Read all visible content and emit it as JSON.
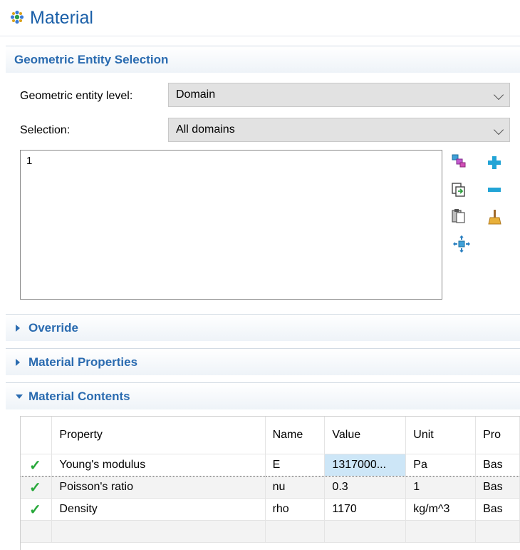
{
  "header": {
    "title": "Material",
    "icon": "material-node-icon"
  },
  "geometric_entity_selection": {
    "section_title": "Geometric Entity Selection",
    "level_label": "Geometric entity level:",
    "level_value": "Domain",
    "selection_label": "Selection:",
    "selection_value": "All domains",
    "selected_items": [
      "1"
    ],
    "tool_icons": [
      "select-objects-icon",
      "add-to-selection-icon",
      "copy-selection-icon",
      "remove-from-selection-icon",
      "paste-selection-icon",
      "clear-selection-icon",
      "zoom-to-selection-icon"
    ]
  },
  "sections": {
    "override": "Override",
    "material_properties": "Material Properties",
    "material_contents": "Material Contents"
  },
  "contents_table": {
    "headers": [
      "",
      "Property",
      "Name",
      "Value",
      "Unit",
      "Pro"
    ],
    "rows": [
      {
        "status": "✓",
        "property": "Young's modulus",
        "name": "E",
        "value": "1317000...",
        "unit": "Pa",
        "group": "Bas"
      },
      {
        "status": "✓",
        "property": "Poisson's ratio",
        "name": "nu",
        "value": "0.3",
        "unit": "1",
        "group": "Bas"
      },
      {
        "status": "✓",
        "property": "Density",
        "name": "rho",
        "value": "1170",
        "unit": "kg/m^3",
        "group": "Bas"
      }
    ]
  },
  "colors": {
    "accent": "#2a6bb0",
    "title": "#1a5fa8",
    "check": "#27a83a",
    "selected_cell": "#cde6f7"
  }
}
